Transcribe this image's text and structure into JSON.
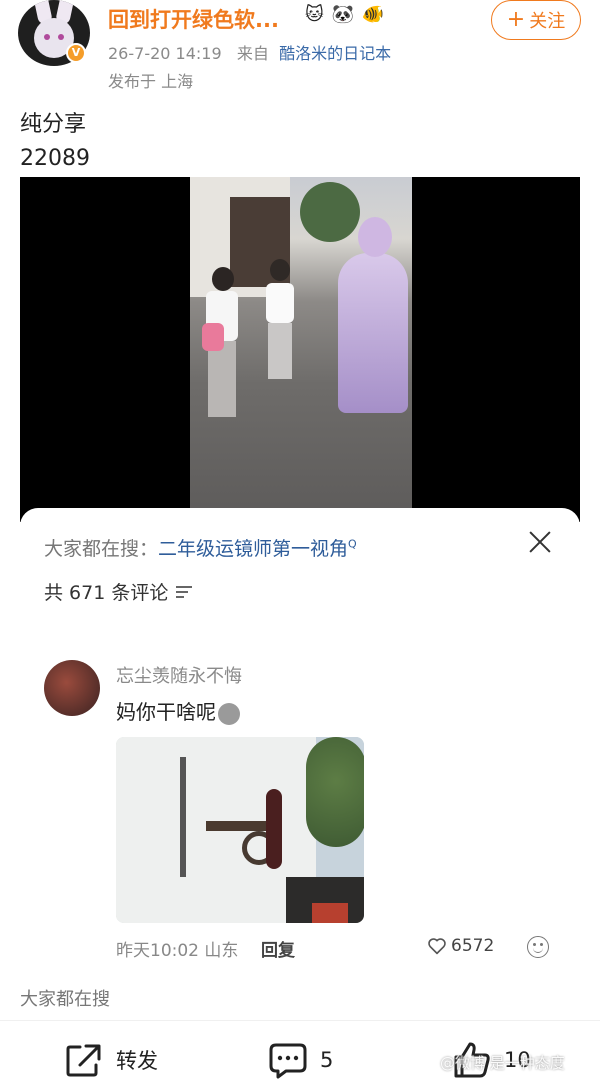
{
  "header": {
    "username": "回到打开绿色软...",
    "badge_emojis": [
      "🐱",
      "🐼",
      "🐠"
    ],
    "vip_badge": "V",
    "timestamp": "26-7-20 14:19",
    "source_prefix": "来自",
    "source_name": "酷洛米的日记本",
    "location": "发布于 上海",
    "follow_plus": "+",
    "follow_label": "关注"
  },
  "post": {
    "line1": "纯分享",
    "line2": "22089"
  },
  "comments_sheet": {
    "search_prefix": "大家都在搜：",
    "search_keyword": "二年级运镜师第一视角",
    "search_q_mark": "Q",
    "count_text": "共 671 条评论",
    "comment": {
      "author": "忘尘羡随永不悔",
      "text": "妈你干啥呢",
      "time_location": "昨天10:02 山东",
      "reply_label": "回复",
      "likes": "6572"
    },
    "bottom_search_label": "大家都在搜"
  },
  "action_bar": {
    "share_label": "转发",
    "comment_count": "5",
    "like_count": "10"
  },
  "watermark": "@微博 是一种态度",
  "colors": {
    "accent_orange": "#f07a1e",
    "link_blue": "#3a6aa8"
  }
}
